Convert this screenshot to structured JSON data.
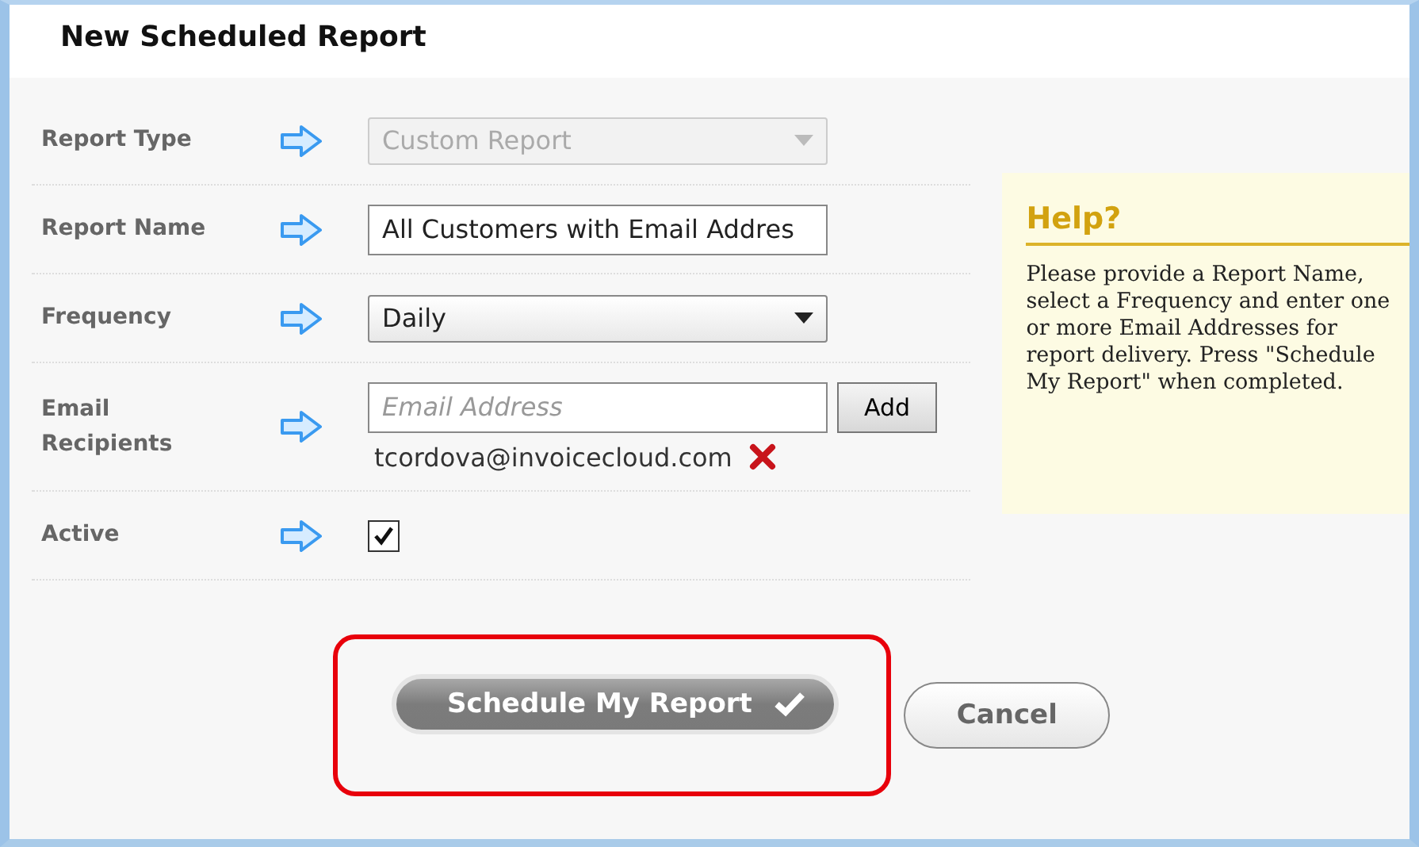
{
  "window": {
    "title": "New Scheduled Report"
  },
  "fields": [
    {
      "kind": "select",
      "label": "Report Type",
      "value": "Custom Report",
      "disabled": true
    },
    {
      "kind": "text",
      "label": "Report Name",
      "value": "All Customers with Email Addres"
    },
    {
      "kind": "select",
      "label": "Frequency",
      "value": "Daily",
      "disabled": false
    },
    {
      "kind": "email",
      "label": "Email Recipients",
      "placeholder": "Email Address",
      "button": "Add",
      "recipients": [
        "tcordova@invoicecloud.com"
      ]
    },
    {
      "kind": "checkbox",
      "label": "Active",
      "checked": true
    }
  ],
  "help": {
    "title": "Help?",
    "text": "Please provide a Report Name, select a Frequency and enter one or more Email Addresses for report delivery. Press \"Schedule My Report\" when completed."
  },
  "actions": {
    "primary": "Schedule My Report",
    "primary_highlighted": true,
    "secondary": "Cancel"
  }
}
